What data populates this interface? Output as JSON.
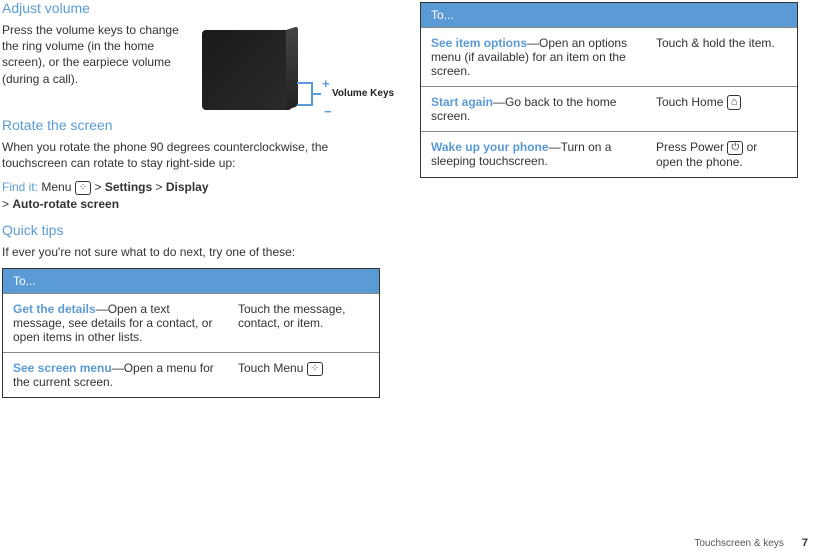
{
  "left": {
    "adjust_heading": "Adjust volume",
    "adjust_text": "Press the volume keys to change the ring volume (in the home screen), or the earpiece volume (during a call).",
    "volume_keys_label": "Volume Keys",
    "rotate_heading": "Rotate the screen",
    "rotate_text": "When you rotate the phone 90 degrees counterclockwise, the touchscreen can rotate to stay right-side up:",
    "find_it_label": "Find it:",
    "find_it_menu": "Menu",
    "find_it_sep": " > ",
    "find_it_settings": "Settings",
    "find_it_display": "Display",
    "find_it_autorotate": "Auto-rotate screen",
    "tips_heading": "Quick tips",
    "tips_text": "If ever you're not sure what to do next, try one of these:",
    "table_header": "To...",
    "rows": [
      {
        "title": "Get the details",
        "desc": "—Open a text message, see details for a contact, or open items in other lists.",
        "action": "Touch the message, contact, or item."
      },
      {
        "title": "See screen menu",
        "desc": "—Open a menu for the current screen.",
        "action_prefix": "Touch Menu ",
        "action_glyph": "menu"
      }
    ]
  },
  "right": {
    "table_header": "To...",
    "rows": [
      {
        "title": "See item options",
        "desc": "—Open an options menu (if available) for an item on the screen.",
        "action": "Touch & hold the item."
      },
      {
        "title": "Start again",
        "desc": "—Go back to the home screen.",
        "action_prefix": "Touch Home ",
        "action_glyph": "home"
      },
      {
        "title": "Wake up your phone",
        "desc": "—Turn on a sleeping touchscreen.",
        "action_prefix": "Press Power ",
        "action_glyph": "power",
        "action_suffix": " or open the phone."
      }
    ]
  },
  "footer": {
    "section": "Touchscreen & keys",
    "page": "7"
  }
}
